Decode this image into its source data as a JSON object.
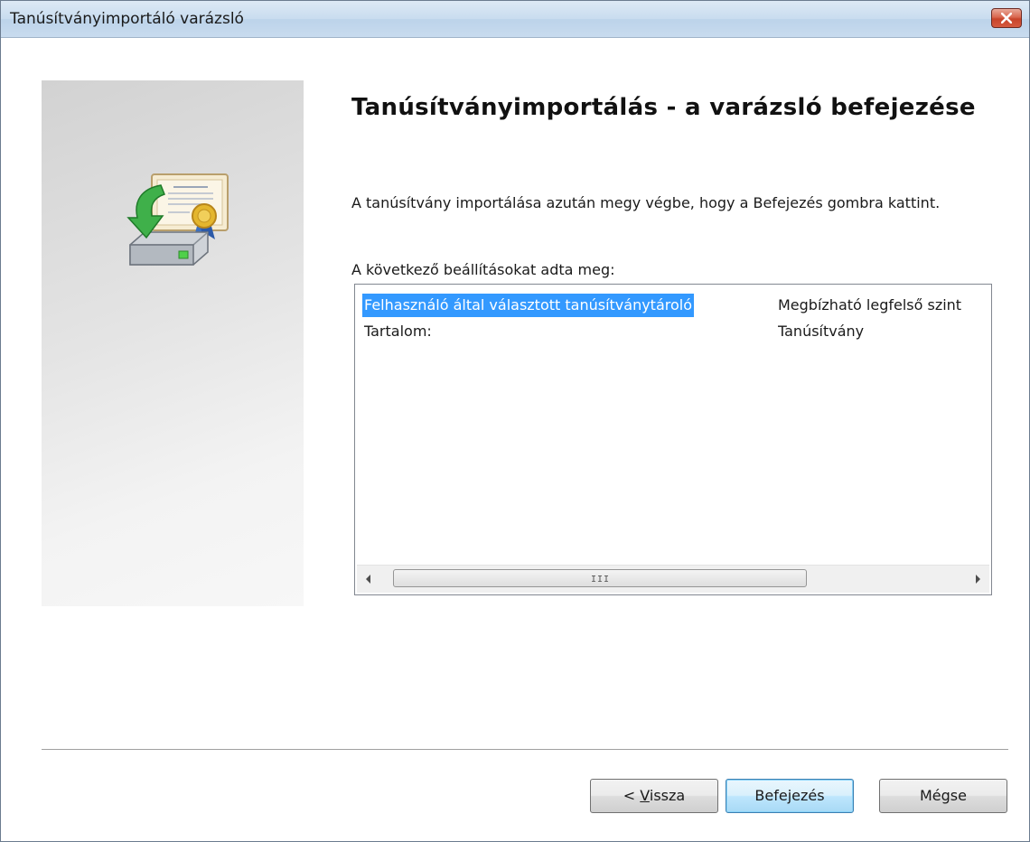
{
  "window": {
    "title": "Tanúsítványimportáló varázsló"
  },
  "heading": "Tanúsítványimportálás - a varázsló befejezése",
  "description": "A tanúsítvány importálása azután megy végbe, hogy a Befejezés gombra kattint.",
  "settings_label": "A következő beállításokat adta meg:",
  "settings_rows": [
    {
      "name": "Felhasználó által választott tanúsítványtároló",
      "value": "Megbízható legfelső szint",
      "selected": true
    },
    {
      "name": "Tartalom:",
      "value": "Tanúsítvány",
      "selected": false
    }
  ],
  "scrollbar": {
    "grip": "III"
  },
  "buttons": {
    "back_prefix": "< ",
    "back_access": "V",
    "back_rest": "issza",
    "finish": "Befejezés",
    "cancel": "Mégse"
  },
  "colors": {
    "selection": "#3399ff",
    "close_button": "#c8442a",
    "default_button_border": "#3c7fb1"
  }
}
